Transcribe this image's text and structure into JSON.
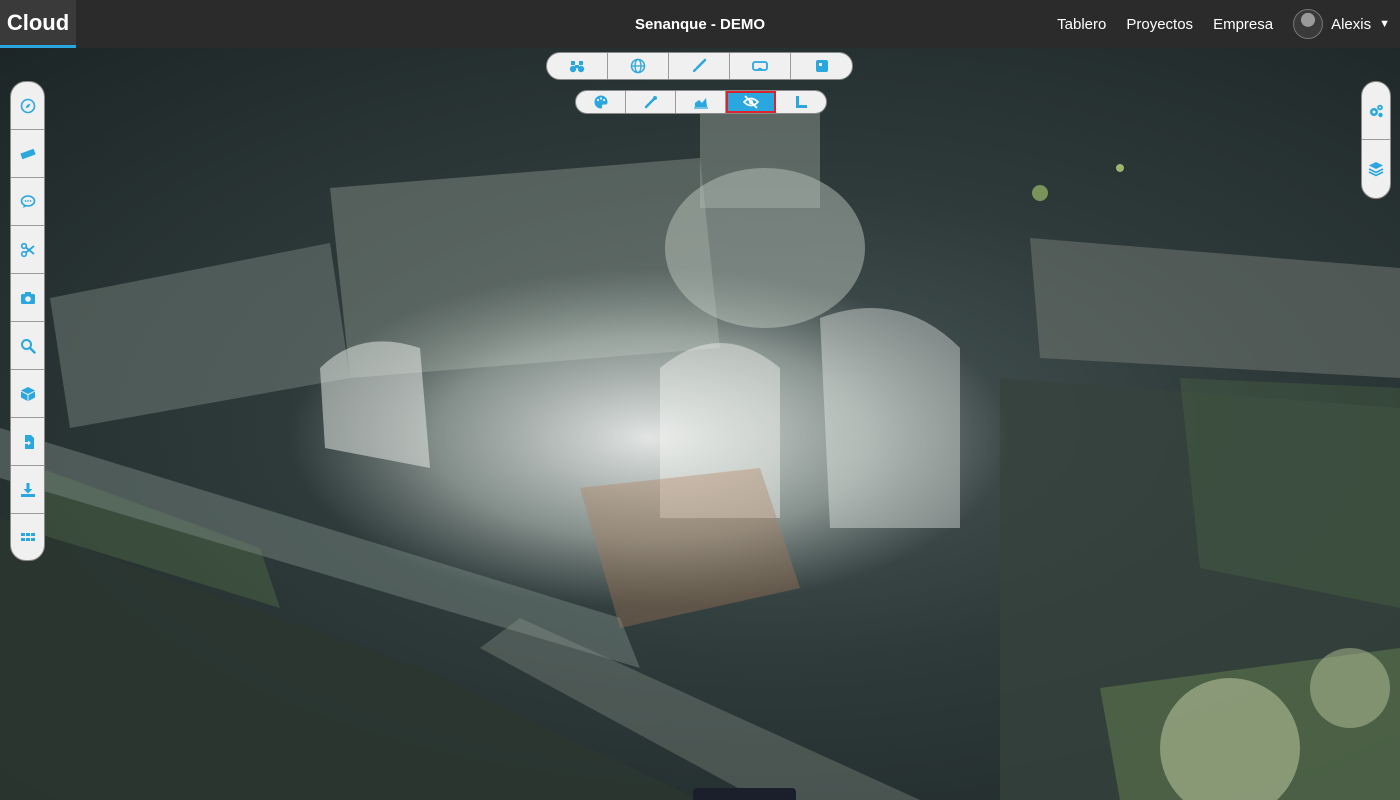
{
  "app": {
    "brand": "Cloud",
    "title": "Senanque - DEMO"
  },
  "nav": {
    "links": [
      "Tablero",
      "Proyectos",
      "Empresa"
    ],
    "user_name": "Alexis"
  },
  "colors": {
    "accent": "#2aa7df",
    "topbar": "#2b2b2b",
    "highlight_border": "#d9232d"
  },
  "toolbar_top": {
    "icons": [
      "binoculars-icon",
      "globe-icon",
      "brush-icon",
      "vr-headset-icon",
      "square-icon"
    ]
  },
  "toolbar_sub": {
    "icons": [
      "palette-icon",
      "eyedropper-icon",
      "area-chart-icon",
      "eye-slash-icon",
      "ruler-corner-icon"
    ],
    "active_index": 3
  },
  "sidebar_left": {
    "icons": [
      "compass-icon",
      "ruler-icon",
      "comment-icon",
      "scissors-icon",
      "camera-icon",
      "search-icon",
      "cube-icon",
      "file-import-icon",
      "download-icon",
      "apps-grid-icon"
    ]
  },
  "sidebar_right": {
    "icons": [
      "settings-gears-icon",
      "layers-icon"
    ]
  }
}
